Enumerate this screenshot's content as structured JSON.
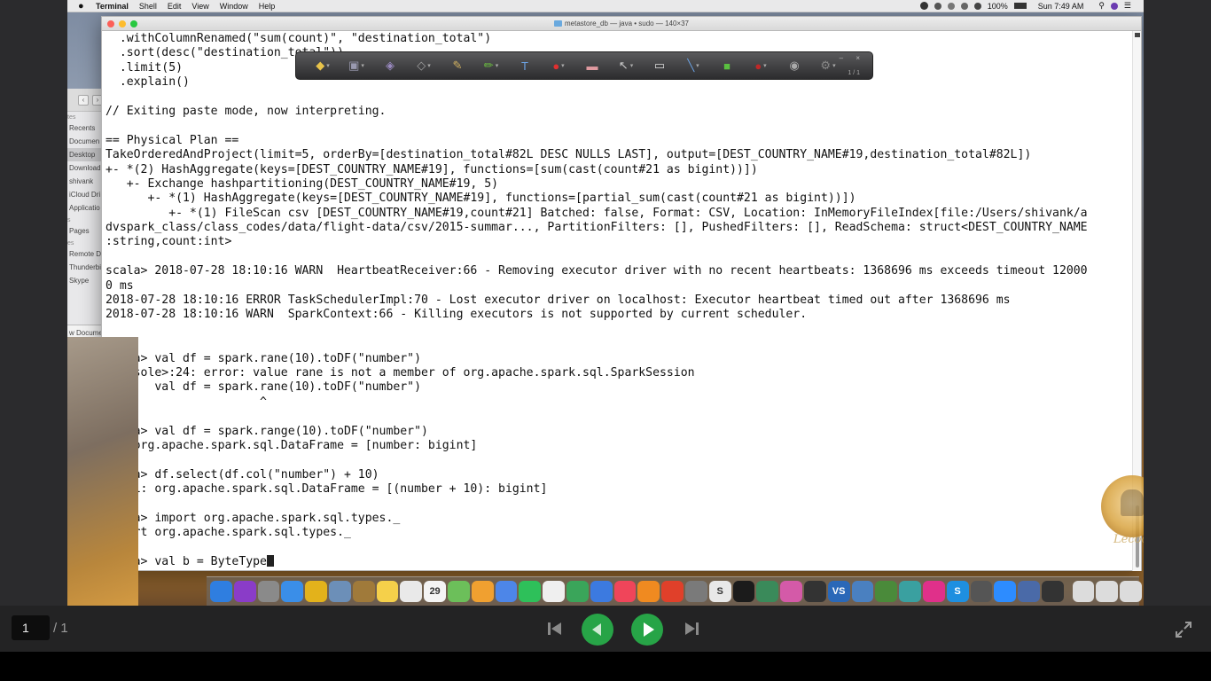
{
  "menubar": {
    "apple_glyph": "",
    "app_name": "Terminal",
    "menus": [
      "Shell",
      "Edit",
      "View",
      "Window",
      "Help"
    ],
    "battery": "100%",
    "clock": "Sun 7:49 AM"
  },
  "finder": {
    "items": [
      {
        "label": "tes",
        "type": "section"
      },
      {
        "label": "Recents"
      },
      {
        "label": "Documen"
      },
      {
        "label": "Desktop",
        "selected": true
      },
      {
        "label": "Download"
      },
      {
        "label": "shivank"
      },
      {
        "label": "iCloud Dri"
      },
      {
        "label": "Applicatio"
      },
      {
        "label": "s",
        "type": "section"
      },
      {
        "label": "Pages"
      },
      {
        "label": "es",
        "type": "section"
      },
      {
        "label": "Remote D"
      },
      {
        "label": "Thunderbi"
      },
      {
        "label": "Skype"
      }
    ],
    "bottom_label": "w Docume"
  },
  "terminal": {
    "title": "metastore_db — java • sudo — 140×37",
    "lines": [
      "  .withColumnRenamed(\"sum(count)\", \"destination_total\")",
      "  .sort(desc(\"destination_total\"))",
      "  .limit(5)",
      "  .explain()",
      "",
      "// Exiting paste mode, now interpreting.",
      "",
      "== Physical Plan ==",
      "TakeOrderedAndProject(limit=5, orderBy=[destination_total#82L DESC NULLS LAST], output=[DEST_COUNTRY_NAME#19,destination_total#82L])",
      "+- *(2) HashAggregate(keys=[DEST_COUNTRY_NAME#19], functions=[sum(cast(count#21 as bigint))])",
      "   +- Exchange hashpartitioning(DEST_COUNTRY_NAME#19, 5)",
      "      +- *(1) HashAggregate(keys=[DEST_COUNTRY_NAME#19], functions=[partial_sum(cast(count#21 as bigint))])",
      "         +- *(1) FileScan csv [DEST_COUNTRY_NAME#19,count#21] Batched: false, Format: CSV, Location: InMemoryFileIndex[file:/Users/shivank/a",
      "dvspark_class/class_codes/data/flight-data/csv/2015-summar..., PartitionFilters: [], PushedFilters: [], ReadSchema: struct<DEST_COUNTRY_NAME",
      ":string,count:int>",
      "",
      "scala> 2018-07-28 18:10:16 WARN  HeartbeatReceiver:66 - Removing executor driver with no recent heartbeats: 1368696 ms exceeds timeout 12000",
      "0 ms",
      "2018-07-28 18:10:16 ERROR TaskSchedulerImpl:70 - Lost executor driver on localhost: Executor heartbeat timed out after 1368696 ms",
      "2018-07-28 18:10:16 WARN  SparkContext:66 - Killing executors is not supported by current scheduler.",
      "",
      "",
      "scala> val df = spark.rane(10).toDF(\"number\")",
      "<console>:24: error: value rane is not a member of org.apache.spark.sql.SparkSession",
      "       val df = spark.rane(10).toDF(\"number\")",
      "                      ^",
      "",
      "scala> val df = spark.range(10).toDF(\"number\")",
      "df: org.apache.spark.sql.DataFrame = [number: bigint]",
      "",
      "scala> df.select(df.col(\"number\") + 10)",
      "res11: org.apache.spark.sql.DataFrame = [(number + 10): bigint]",
      "",
      "scala> import org.apache.spark.sql.types._",
      "import org.apache.spark.sql.types._",
      "",
      "scala> val b = ByteType"
    ]
  },
  "annotation_toolbar": {
    "page": "1 / 1",
    "window_buttons": "– ×",
    "tools": [
      "highlight-note-icon",
      "stamp-icon",
      "arrow-shape-icon",
      "eraser-icon",
      "pencil-icon",
      "marker-icon",
      "text-tool-icon",
      "shapes-icon",
      "eraser-pink-icon",
      "pointer-icon",
      "rectangle-icon",
      "line-tool-icon",
      "fill-color-icon",
      "record-icon",
      "spotlight-icon",
      "settings-icon"
    ]
  },
  "watermark": {
    "text": "Lecoo"
  },
  "dock": {
    "apps": [
      {
        "name": "finder",
        "color": "#2f7ee0"
      },
      {
        "name": "siri",
        "color": "#8a3cc8"
      },
      {
        "name": "launchpad",
        "color": "#8a8a8a"
      },
      {
        "name": "safari",
        "color": "#3a8ee8"
      },
      {
        "name": "chrome",
        "color": "#e3b21b"
      },
      {
        "name": "preview",
        "color": "#6c8fb8"
      },
      {
        "name": "notes-brown",
        "color": "#a07a3a"
      },
      {
        "name": "stickies",
        "color": "#f5d04a"
      },
      {
        "name": "textedit",
        "color": "#e9e9e9"
      },
      {
        "name": "calendar",
        "color": "#f4f4f4",
        "label": "29"
      },
      {
        "name": "maps",
        "color": "#6cbf5a"
      },
      {
        "name": "photos",
        "color": "#f0a030"
      },
      {
        "name": "messages-alt",
        "color": "#4d86e8"
      },
      {
        "name": "facetime",
        "color": "#2ec05a"
      },
      {
        "name": "reminders",
        "color": "#efefef"
      },
      {
        "name": "numbers",
        "color": "#3aa55a"
      },
      {
        "name": "keynote",
        "color": "#3c7ae0"
      },
      {
        "name": "music",
        "color": "#f0455a"
      },
      {
        "name": "books",
        "color": "#f08a20"
      },
      {
        "name": "app-store",
        "color": "#e0402a"
      },
      {
        "name": "system-prefs",
        "color": "#7a7a7a"
      },
      {
        "name": "skitch",
        "color": "#e8e8e8",
        "label": "S"
      },
      {
        "name": "terminal",
        "color": "#1b1b1b"
      },
      {
        "name": "network",
        "color": "#3a8a5a"
      },
      {
        "name": "flower-app",
        "color": "#d45aa8"
      },
      {
        "name": "camera-dark",
        "color": "#333"
      },
      {
        "name": "vscode",
        "color": "#2a68b8",
        "label": "VS"
      },
      {
        "name": "thunderbird",
        "color": "#4a80c0"
      },
      {
        "name": "android-studio",
        "color": "#4a8a3a"
      },
      {
        "name": "globe-app",
        "color": "#3aa0a0"
      },
      {
        "name": "flower-pink",
        "color": "#e0308a"
      },
      {
        "name": "skype",
        "color": "#1e8fe0",
        "label": "S"
      },
      {
        "name": "screen-tool",
        "color": "#555"
      },
      {
        "name": "zoom",
        "color": "#2d8cff"
      },
      {
        "name": "virtualbox",
        "color": "#4a6aa8"
      },
      {
        "name": "console",
        "color": "#333"
      },
      {
        "name": "folder-1",
        "color": "#dcdcdc"
      },
      {
        "name": "folder-2",
        "color": "#dcdcdc"
      },
      {
        "name": "folder-3",
        "color": "#dcdcdc"
      },
      {
        "name": "trash",
        "color": "#cfcfcf"
      }
    ]
  },
  "presentation_bar": {
    "current_page": "1",
    "total_pages": "/ 1"
  },
  "colors": {
    "play_green": "#27a447",
    "terminal_bg": "#ffffff",
    "bar_bg": "#232324"
  }
}
